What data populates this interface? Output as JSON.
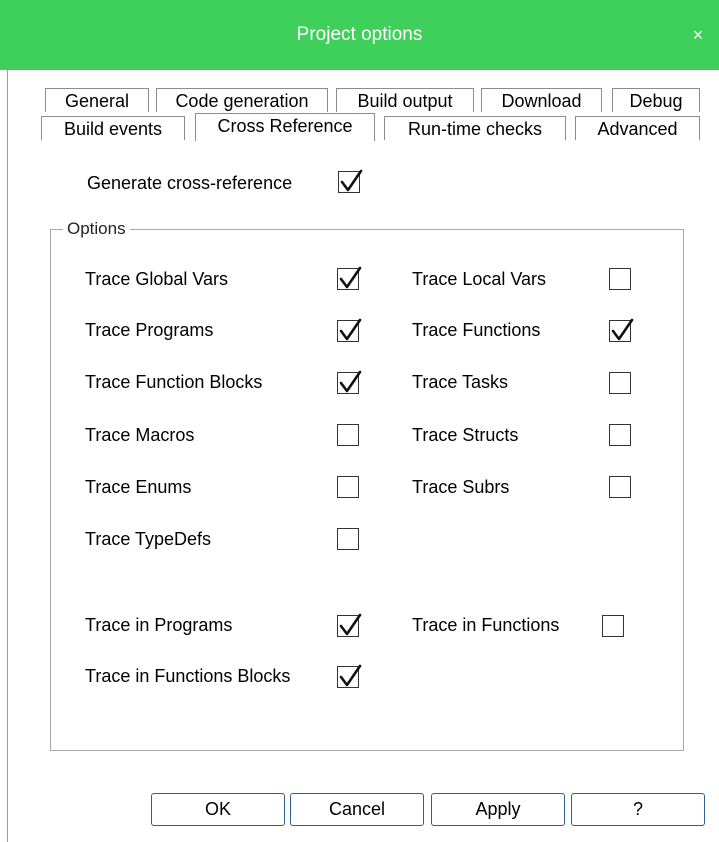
{
  "window": {
    "title": "Project options",
    "close_icon": "×"
  },
  "tabs_row1": [
    "General",
    "Code generation",
    "Build output",
    "Download",
    "Debug"
  ],
  "tabs_row2": [
    "Build events",
    "Cross Reference",
    "Run-time checks",
    "Advanced"
  ],
  "active_tab": "Cross Reference",
  "generate": {
    "label": "Generate cross-reference",
    "checked": true
  },
  "options": {
    "legend": "Options",
    "items": [
      {
        "label": "Trace Global Vars",
        "checked": true
      },
      {
        "label": "Trace Local Vars",
        "checked": false
      },
      {
        "label": "Trace Programs",
        "checked": true
      },
      {
        "label": "Trace Functions",
        "checked": true
      },
      {
        "label": "Trace Function Blocks",
        "checked": true
      },
      {
        "label": "Trace Tasks",
        "checked": false
      },
      {
        "label": "Trace Macros",
        "checked": false
      },
      {
        "label": "Trace Structs",
        "checked": false
      },
      {
        "label": "Trace Enums",
        "checked": false
      },
      {
        "label": "Trace Subrs",
        "checked": false
      },
      {
        "label": "Trace TypeDefs",
        "checked": false
      },
      {
        "label": "Trace in Programs",
        "checked": true
      },
      {
        "label": "Trace in Functions",
        "checked": false
      },
      {
        "label": "Trace in Functions Blocks",
        "checked": true
      }
    ]
  },
  "buttons": {
    "ok": "OK",
    "cancel": "Cancel",
    "apply": "Apply",
    "help": "?"
  }
}
